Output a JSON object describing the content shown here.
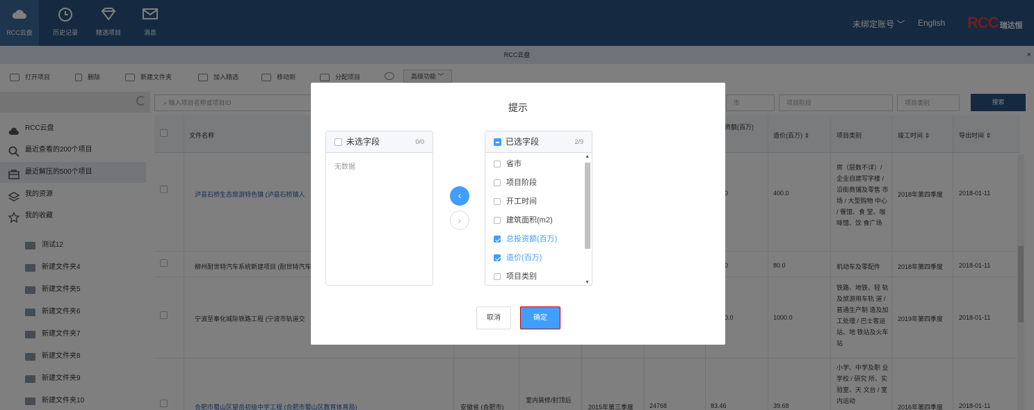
{
  "nav": {
    "items": [
      {
        "label": "RCC云盘",
        "icon": "cloud-icon"
      },
      {
        "label": "历史记录",
        "icon": "clock-icon"
      },
      {
        "label": "精选项目",
        "icon": "diamond-icon"
      },
      {
        "label": "消息",
        "icon": "mail-icon"
      }
    ],
    "account": "未绑定账号",
    "language": "English",
    "logo_text": "RCC",
    "logo_sub": "瑞达恒"
  },
  "window_title": "RCC云盘",
  "close": "×",
  "toolbar": {
    "open": "打开项目",
    "delete": "删除",
    "new_folder": "新建文件夹",
    "add_featured": "加入精选",
    "move_to": "移动到",
    "assign": "分配项目",
    "advanced": "高级功能"
  },
  "sidebar": {
    "items": [
      {
        "label": "RCC云盘"
      },
      {
        "label": "最近查看的200个项目"
      },
      {
        "label": "最近解压的500个项目"
      },
      {
        "label": "我的资源"
      },
      {
        "label": "我的收藏"
      }
    ],
    "folders": [
      "测试12",
      "新建文件夹4",
      "新建文件夹5",
      "新建文件夹6",
      "新建文件夹7",
      "新建文件夹8",
      "新建文件夹9",
      "新建文件夹10"
    ]
  },
  "search": {
    "placeholder": "输入项目名称或项目ID",
    "filter_city": "市",
    "filter_stage": "项目阶段",
    "filter_category": "项目类别",
    "button": "搜索"
  },
  "table": {
    "headers": {
      "name": "文件名称",
      "investment": "资额(百万)",
      "cost": "造价(百万)",
      "category": "项目类别",
      "finish": "竣工时间",
      "export": "导出时间"
    },
    "rows": [
      {
        "name": "泸县石桥生态旅游特色镇 (泸县石桥镇人",
        "investment": "0",
        "cost": "400.0",
        "category": "房（层数不详）/ 企业自建写字楼 / 沿街商铺及零售 市场 / 大型购物 中心 / 餐馆、食 堂、咖啡馆、饮 食广场",
        "category_top": "/////////////////",
        "finish": "2018年第四季度",
        "export": "2018-01-11"
      },
      {
        "name": "柳州耐世特汽车系统新建项目 (耐世特汽车",
        "investment": "0",
        "cost": "80.0",
        "category": "机动车及零配件",
        "finish": "2018年第四季度",
        "export": "2018-01-11"
      },
      {
        "name": "宁波至奉化城际铁路工程 (宁波市轨道交",
        "investment": "0.0",
        "cost": "1000.0",
        "category": "铁路、地铁、轻 轨及旅游用车轨 道 / 普通生产制 造及加工处理 / 巴士客运站、地 铁站及火车站",
        "finish": "2019年第四季度",
        "export": "2018-01-11"
      },
      {
        "name": "合肥市蜀山区望岳初级中学工程 (合肥市蜀山区教育体育局)",
        "province": "安徽省 (合肥市)",
        "stage": "室内装修/封顶后",
        "start": "2015年第三季度",
        "area": "24768",
        "investment": "83.46",
        "cost": "39.68",
        "category": "小学、中学及职 业学校 / 研究 所、实验室、天 文台 / 室内运动",
        "finish": "2016年第四季度",
        "export": "2018-01-11"
      }
    ]
  },
  "modal": {
    "title": "提示",
    "left_panel": {
      "title": "未选字段",
      "count": "0/0",
      "empty": "无数据"
    },
    "right_panel": {
      "title": "已选字段",
      "count": "2/9",
      "fields": [
        {
          "label": "省市",
          "checked": false
        },
        {
          "label": "项目阶段",
          "checked": false
        },
        {
          "label": "开工时间",
          "checked": false
        },
        {
          "label": "建筑面积(m2)",
          "checked": false
        },
        {
          "label": "总投资额(百万)",
          "checked": true
        },
        {
          "label": "造价(百万)",
          "checked": true
        },
        {
          "label": "项目类别",
          "checked": false
        }
      ]
    },
    "cancel": "取消",
    "confirm": "确定"
  },
  "colors": {
    "nav_bg": "#2b5481",
    "primary": "#409eff",
    "link": "#2b5ea8"
  }
}
